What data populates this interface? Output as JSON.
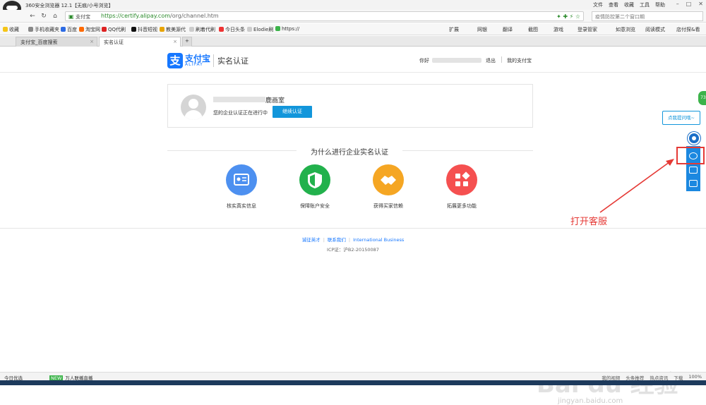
{
  "browser": {
    "title": "360安全浏览器 12.1【无痕/小号浏览】",
    "menus": [
      "文件",
      "查看",
      "收藏",
      "工具",
      "帮助"
    ],
    "address": {
      "site": "支付宝",
      "scheme_host": "https://certify.alipay.com",
      "path": "/org/channel.htm"
    },
    "search_placeholder": "疫情防控第二个窗口期",
    "bookmarks": [
      "收藏",
      "手机收藏夹",
      "百度",
      "淘宝网",
      "QQ代刷",
      "抖音短视",
      "教美源代",
      "刷着代刷",
      "今日头条",
      "Elodie刷",
      "https://"
    ],
    "bookmarks_right": [
      "扩展",
      "网银",
      "翻译",
      "截图",
      "游戏",
      "登录管家",
      "如意浏览",
      "阅读模式",
      "店付探&看",
      "今日优选"
    ],
    "tabs": [
      {
        "label": "支付宝_百度搜索"
      },
      {
        "label": "实名认证"
      }
    ]
  },
  "header": {
    "logo_char": "支",
    "brand": "支付宝",
    "brand_sub": "ALIPAY",
    "title": "实名认证",
    "hello": "你好",
    "logout": "退出",
    "my_alipay": "我的支付宝"
  },
  "card": {
    "company_suffix": "鹿画室",
    "pending": "您的企业认证正在进行中",
    "continue_btn": "继续认证"
  },
  "why": {
    "heading": "为什么进行企业实名认证",
    "features": [
      {
        "label": "核实真实信息",
        "color": "#4d90f0"
      },
      {
        "label": "保障账户安全",
        "color": "#22b14c"
      },
      {
        "label": "获得买家信赖",
        "color": "#f5a623"
      },
      {
        "label": "拓展更多功能",
        "color": "#f55050"
      }
    ]
  },
  "footer": {
    "links": [
      "诚征英才",
      "联系我们",
      "International Business"
    ],
    "icp": "ICP证：沪B2-20150087"
  },
  "service": {
    "tooltip": "点我提问哦~"
  },
  "annotation": {
    "callout": "打开客服"
  },
  "status": {
    "left": "今日优选",
    "middle_badge": "NEW",
    "middle": "万人联播直播",
    "right": [
      "我的视频",
      "头条推荐",
      "热点资讯",
      "下载",
      "100%"
    ]
  },
  "watermark": {
    "main": "Bai du 经验",
    "sub": "jingyan.baidu.com"
  }
}
